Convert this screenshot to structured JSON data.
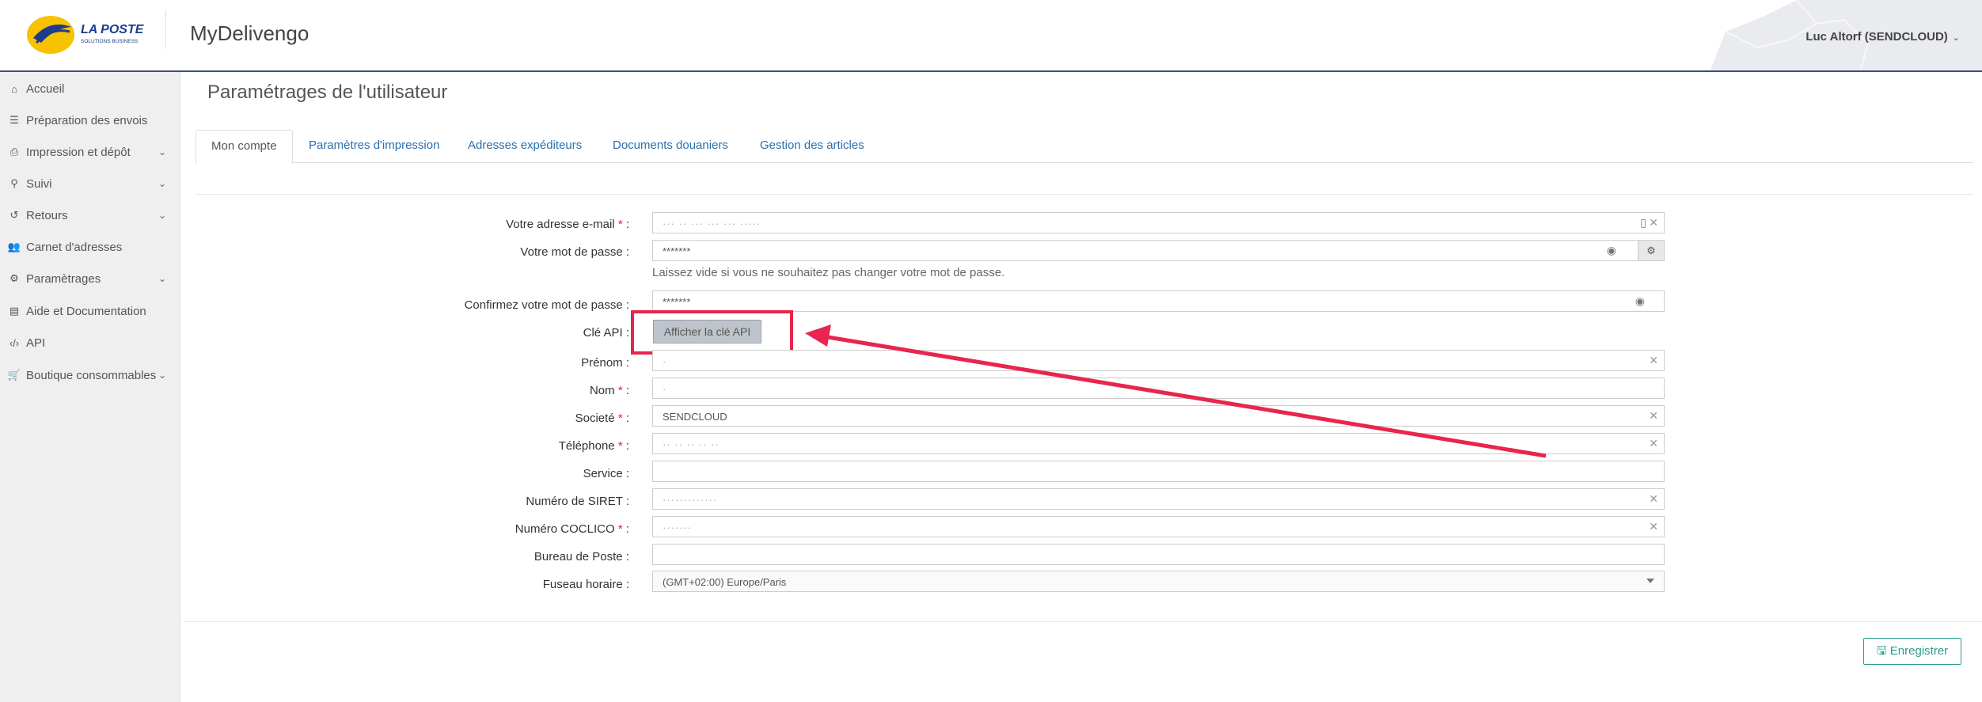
{
  "header": {
    "logo_text": "LA POSTE",
    "logo_sub": "SOLUTIONS BUSINESS",
    "app_title": "MyDelivengo",
    "user": "Luc Altorf (SENDCLOUD)"
  },
  "sidebar": {
    "items": [
      {
        "label": "Accueil",
        "icon": "home-icon"
      },
      {
        "label": "Préparation des envois",
        "icon": "list-icon"
      },
      {
        "label": "Impression et dépôt",
        "icon": "print-icon"
      },
      {
        "label": "Suivi",
        "icon": "search-icon"
      },
      {
        "label": "Retours",
        "icon": "history-icon"
      },
      {
        "label": "Carnet d'adresses",
        "icon": "users-icon"
      },
      {
        "label": "Paramètrages",
        "icon": "gear-icon"
      },
      {
        "label": "Aide et Documentation",
        "icon": "book-icon"
      },
      {
        "label": "API",
        "icon": "code-icon"
      },
      {
        "label": "Boutique consommables",
        "icon": "cart-icon"
      }
    ]
  },
  "page": {
    "title": "Paramétrages de l'utilisateur"
  },
  "tabs": [
    {
      "label": "Mon compte"
    },
    {
      "label": "Paramètres d'impression"
    },
    {
      "label": "Adresses expéditeurs"
    },
    {
      "label": "Documents douaniers"
    },
    {
      "label": "Gestion des articles"
    }
  ],
  "form": {
    "email": {
      "label": "Votre adresse e-mail",
      "value": "··· ·· ··· ··· ··· ·····"
    },
    "password": {
      "label": "Votre mot de passe :",
      "value": "*******"
    },
    "password_help": "Laissez vide si vous ne souhaitez pas changer votre mot de passe.",
    "confirm": {
      "label": "Confirmez votre mot de passe :",
      "value": "*******"
    },
    "api_key": {
      "label": "Clé API :",
      "button": "Afficher la clé API"
    },
    "firstname": {
      "label": "Prénom :",
      "value": "·"
    },
    "lastname": {
      "label": "Nom",
      "value": "·"
    },
    "company": {
      "label": "Societé",
      "value": "SENDCLOUD"
    },
    "phone": {
      "label": "Téléphone",
      "value": "·· ·· ·· ·· ··"
    },
    "service": {
      "label": "Service :",
      "value": ""
    },
    "siret": {
      "label": "Numéro de SIRET :",
      "value": "·············"
    },
    "coclico": {
      "label": "Numéro COCLICO",
      "value": "·······"
    },
    "post_office": {
      "label": "Bureau de Poste :",
      "value": ""
    },
    "timezone": {
      "label": "Fuseau horaire :",
      "value": "(GMT+02:00) Europe/Paris"
    },
    "required_suffix": " :",
    "required_mark": "*"
  },
  "actions": {
    "save": "Enregistrer"
  },
  "colors": {
    "accent": "#2a6fb0",
    "highlight": "#e7254e",
    "save": "#2a9d8f",
    "header_border": "#3b4a8c"
  }
}
